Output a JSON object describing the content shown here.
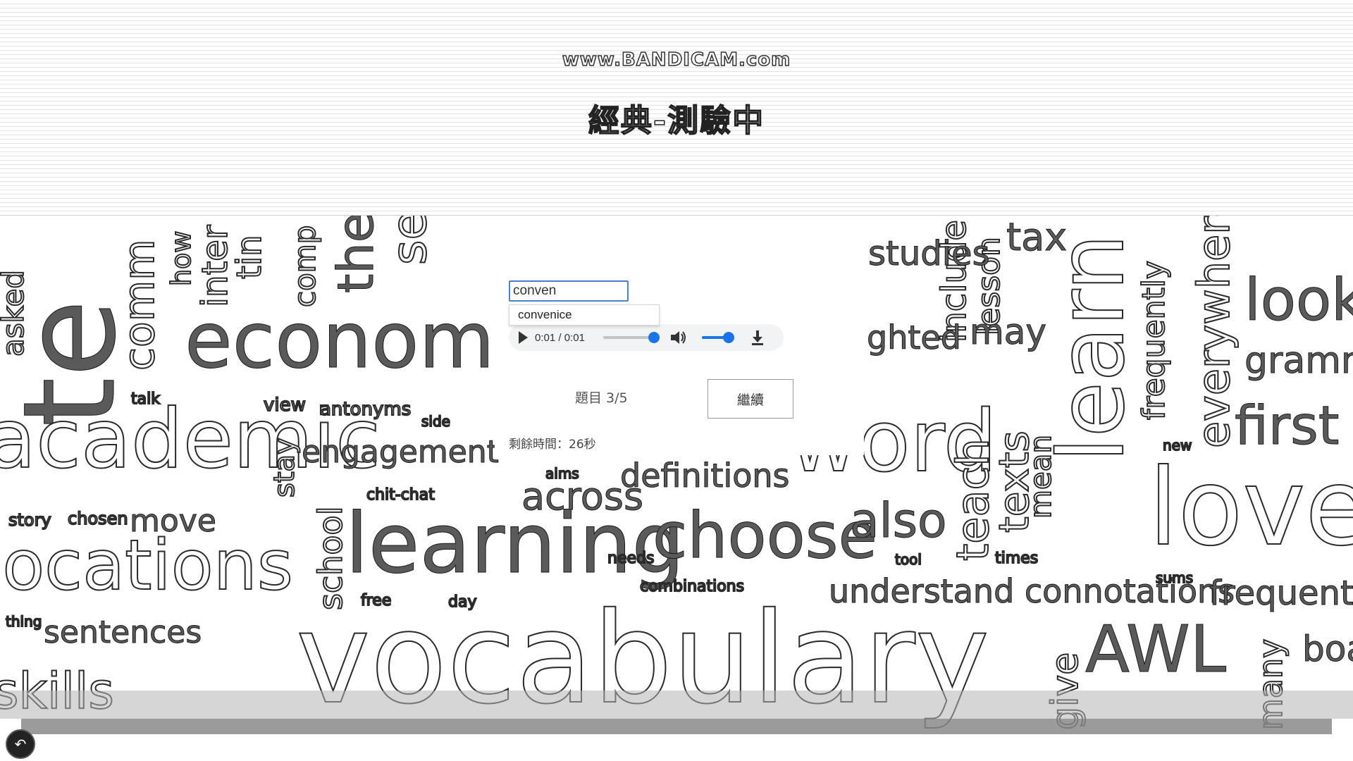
{
  "watermark": "www.BANDICAM.com",
  "page_title": "經典-測驗中",
  "quiz": {
    "answer_value": "conven",
    "suggestion": "convenice",
    "audio": {
      "current_time": "0:01",
      "separator": " / ",
      "total_time": "0:01",
      "progress": 1.0,
      "volume": 1.0
    },
    "question_counter": "題目 3/5",
    "next_button_label": "繼續",
    "time_remaining": "剩餘時間：26秒"
  },
  "wordcloud": {
    "words": [
      "asked",
      "te",
      "comm",
      "how",
      "inter",
      "tin",
      "comp",
      "the",
      "se",
      "economy",
      "academic",
      "talk",
      "view",
      "antonyms",
      "side",
      "engagement",
      "stay",
      "story",
      "chosen",
      "move",
      "locations",
      "school",
      "learning",
      "across",
      "definitions",
      "choose",
      "also",
      "understand connotations",
      "word",
      "include",
      "lesson",
      "tax",
      "studies",
      "ghted",
      "may",
      "teach",
      "texts",
      "mean",
      "learn",
      "frequently",
      "everywhere",
      "look",
      "grammar",
      "first",
      "love",
      "frequent",
      "AWL",
      "give",
      "many",
      "board",
      "vocabulary",
      "sentences",
      "skills",
      "combinations",
      "needs",
      "tool",
      "times",
      "free",
      "day",
      "thing",
      "chit-chat",
      "aims",
      "new",
      "sums"
    ]
  },
  "icons": {
    "play": "play-icon",
    "volume": "volume-icon",
    "download": "download-icon",
    "corner": "back-arrow-icon"
  },
  "colors": {
    "accent": "#1a73e8",
    "input_border": "#4a7fd6"
  }
}
